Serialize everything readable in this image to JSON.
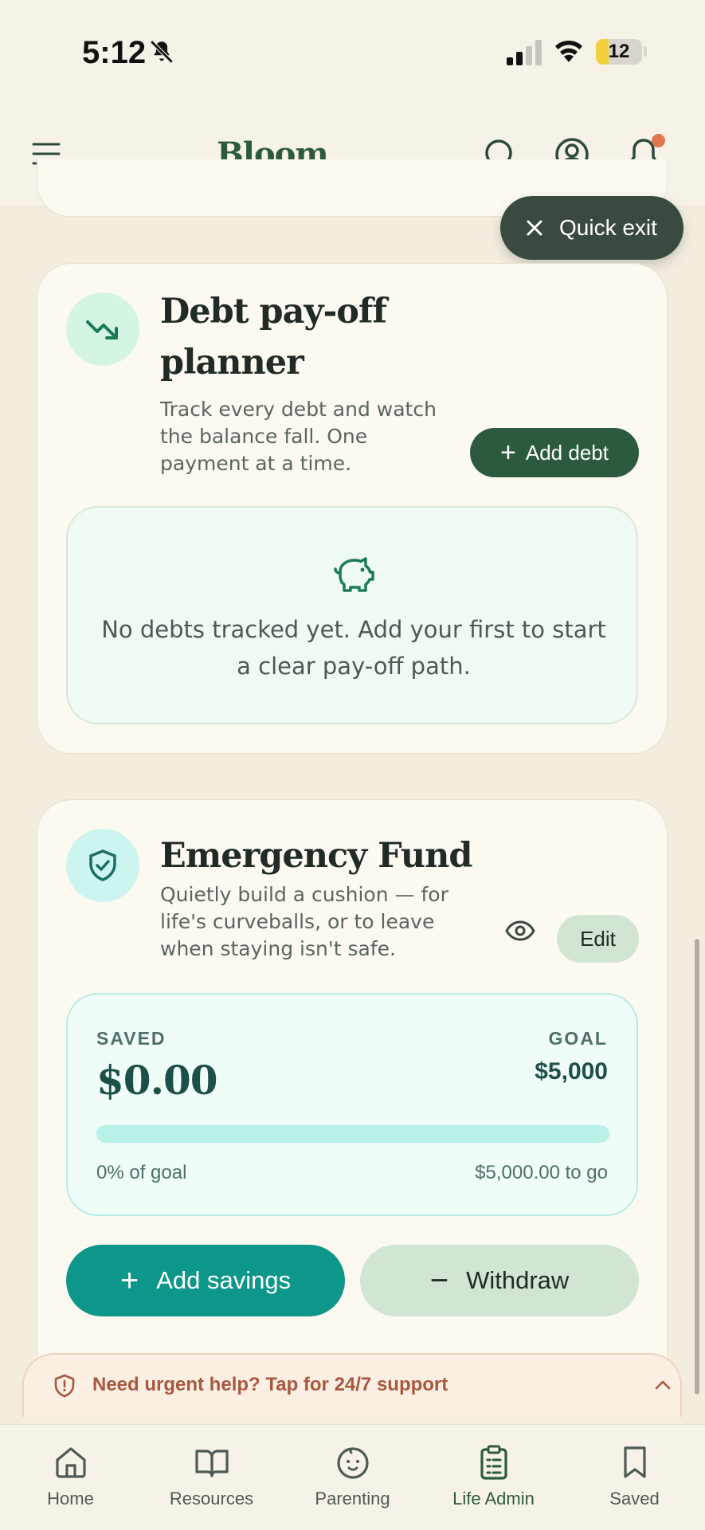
{
  "status_bar": {
    "time": "5:12",
    "battery": "12"
  },
  "header": {
    "logo": "Bloom",
    "logo_dot": "."
  },
  "quick_exit": {
    "label": "Quick exit"
  },
  "debt_card": {
    "title_line1": "Debt pay-off",
    "title_line2": "planner",
    "description": "Track every debt and watch the balance fall. One payment at a time.",
    "add_button": "Add debt",
    "empty_message": "No debts tracked yet. Add your first to start a clear pay-off path."
  },
  "fund_card": {
    "title": "Emergency Fund",
    "description": "Quietly build a cushion — for life's curveballs, or to leave when staying isn't safe.",
    "edit_button": "Edit",
    "saved_label": "SAVED",
    "saved_amount": "$0.00",
    "goal_label": "GOAL",
    "goal_amount": "$5,000",
    "progress_fraction": 0,
    "percent_text": "0% of goal",
    "remaining_text": "$5,000.00 to go",
    "add_savings": "Add savings",
    "withdraw": "Withdraw"
  },
  "urgent": {
    "text": "Need urgent help? Tap for 24/7 support"
  },
  "nav": {
    "items": [
      {
        "label": "Home",
        "icon": "home-icon"
      },
      {
        "label": "Resources",
        "icon": "book-icon"
      },
      {
        "label": "Parenting",
        "icon": "baby-face-icon"
      },
      {
        "label": "Life Admin",
        "icon": "clipboard-icon"
      },
      {
        "label": "Saved",
        "icon": "bookmark-icon"
      }
    ],
    "active_index": 3
  },
  "colors": {
    "brand_green": "#2c5a3f",
    "teal": "#0d978a",
    "accent_orange": "#d9774f",
    "urgent_text": "#a8583e"
  }
}
